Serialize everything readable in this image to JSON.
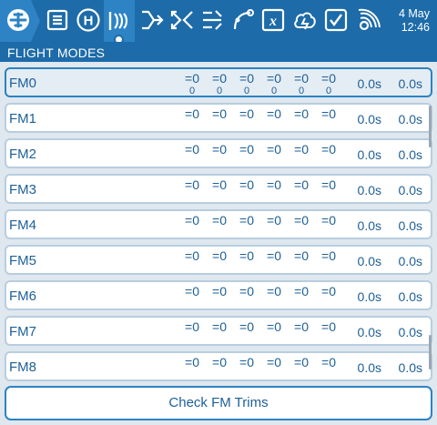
{
  "topbar": {
    "icons": [
      {
        "name": "model-settings-icon"
      },
      {
        "name": "heli-setup-icon",
        "glyph": "H"
      },
      {
        "name": "flight-modes-icon"
      },
      {
        "name": "inputs-icon"
      },
      {
        "name": "mixes-icon"
      },
      {
        "name": "outputs-icon"
      },
      {
        "name": "curves-icon"
      },
      {
        "name": "global-variables-icon",
        "glyph": "x"
      },
      {
        "name": "logical-switches-icon"
      },
      {
        "name": "special-functions-icon"
      },
      {
        "name": "telemetry-icon"
      }
    ],
    "date_line1": "4 May",
    "date_line2": "12:46"
  },
  "page": {
    "title": "FLIGHT MODES"
  },
  "flight_modes": [
    {
      "name": "FM0",
      "trims": [
        "=0",
        "=0",
        "=0",
        "=0",
        "=0",
        "=0"
      ],
      "sub": [
        "0",
        "0",
        "0",
        "0",
        "0",
        "0"
      ],
      "fade_in": "0.0s",
      "fade_out": "0.0s",
      "selected": true
    },
    {
      "name": "FM1",
      "trims": [
        "=0",
        "=0",
        "=0",
        "=0",
        "=0",
        "=0"
      ],
      "sub": [
        "",
        "",
        "",
        "",
        "",
        ""
      ],
      "fade_in": "0.0s",
      "fade_out": "0.0s"
    },
    {
      "name": "FM2",
      "trims": [
        "=0",
        "=0",
        "=0",
        "=0",
        "=0",
        "=0"
      ],
      "sub": [
        "",
        "",
        "",
        "",
        "",
        ""
      ],
      "fade_in": "0.0s",
      "fade_out": "0.0s"
    },
    {
      "name": "FM3",
      "trims": [
        "=0",
        "=0",
        "=0",
        "=0",
        "=0",
        "=0"
      ],
      "sub": [
        "",
        "",
        "",
        "",
        "",
        ""
      ],
      "fade_in": "0.0s",
      "fade_out": "0.0s"
    },
    {
      "name": "FM4",
      "trims": [
        "=0",
        "=0",
        "=0",
        "=0",
        "=0",
        "=0"
      ],
      "sub": [
        "",
        "",
        "",
        "",
        "",
        ""
      ],
      "fade_in": "0.0s",
      "fade_out": "0.0s"
    },
    {
      "name": "FM5",
      "trims": [
        "=0",
        "=0",
        "=0",
        "=0",
        "=0",
        "=0"
      ],
      "sub": [
        "",
        "",
        "",
        "",
        "",
        ""
      ],
      "fade_in": "0.0s",
      "fade_out": "0.0s"
    },
    {
      "name": "FM6",
      "trims": [
        "=0",
        "=0",
        "=0",
        "=0",
        "=0",
        "=0"
      ],
      "sub": [
        "",
        "",
        "",
        "",
        "",
        ""
      ],
      "fade_in": "0.0s",
      "fade_out": "0.0s"
    },
    {
      "name": "FM7",
      "trims": [
        "=0",
        "=0",
        "=0",
        "=0",
        "=0",
        "=0"
      ],
      "sub": [
        "",
        "",
        "",
        "",
        "",
        ""
      ],
      "fade_in": "0.0s",
      "fade_out": "0.0s"
    },
    {
      "name": "FM8",
      "trims": [
        "=0",
        "=0",
        "=0",
        "=0",
        "=0",
        "=0"
      ],
      "sub": [
        "",
        "",
        "",
        "",
        "",
        ""
      ],
      "fade_in": "0.0s",
      "fade_out": "0.0s"
    }
  ],
  "check_button": {
    "label": "Check FM Trims"
  },
  "colors": {
    "header": "#1d6ba8",
    "accent": "#2d83c4",
    "text": "#1d5f98"
  }
}
